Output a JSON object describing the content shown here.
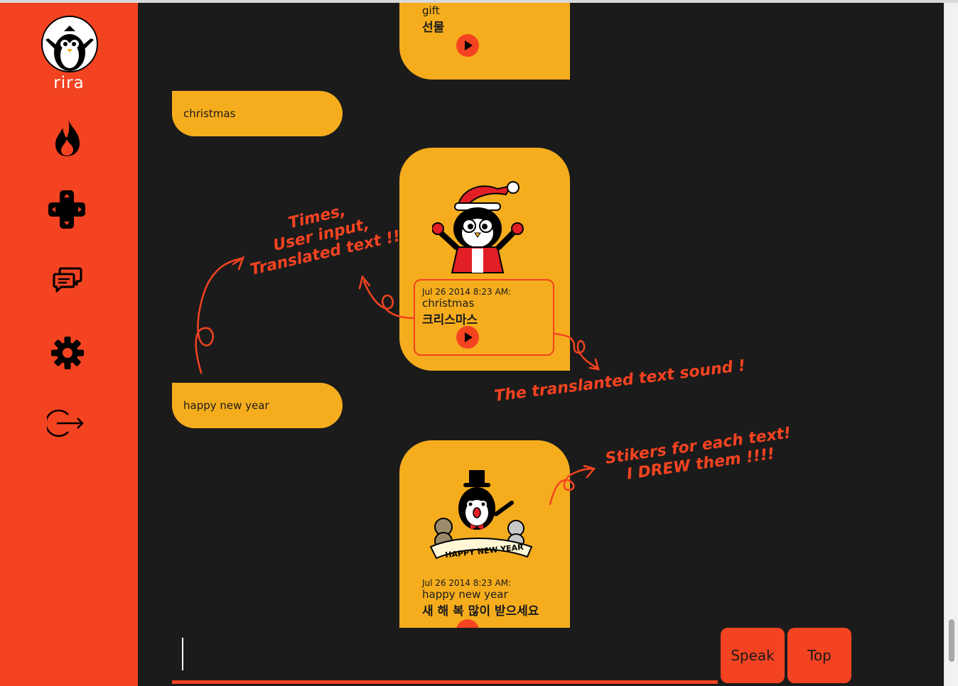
{
  "app": {
    "logo_text": "rira"
  },
  "colors": {
    "accent": "#f44321",
    "bubble": "#f5ad1d",
    "background": "#1b1b1b"
  },
  "sidebar": {
    "icons": [
      "flame-icon",
      "gamepad-icon",
      "chat-icon",
      "gear-icon",
      "logout-icon"
    ]
  },
  "messages": {
    "gift_reply": {
      "source": "gift",
      "translated": "선물"
    },
    "user1": "christmas",
    "reply1": {
      "time": "Jul 26 2014 8:23 AM:",
      "source": "christmas",
      "translated": "크리스마스",
      "sticker": "santa-penguin-sticker"
    },
    "user2": "happy new year",
    "reply2": {
      "time": "Jul 26 2014 8:23 AM:",
      "source": "happy new year",
      "translated": "새 해 복 많이 받으세요",
      "sticker": "new-year-penguin-sticker",
      "banner": "HAPPY NEW YEAR"
    }
  },
  "annotations": {
    "a1": [
      "Times,",
      "User input,",
      "Translated text !!"
    ],
    "a2": "The translanted text sound !",
    "a3": [
      "Stikers for each text!",
      "I DREW them !!!!"
    ]
  },
  "footer": {
    "speak_label": "Speak",
    "top_label": "Top",
    "input_value": ""
  }
}
